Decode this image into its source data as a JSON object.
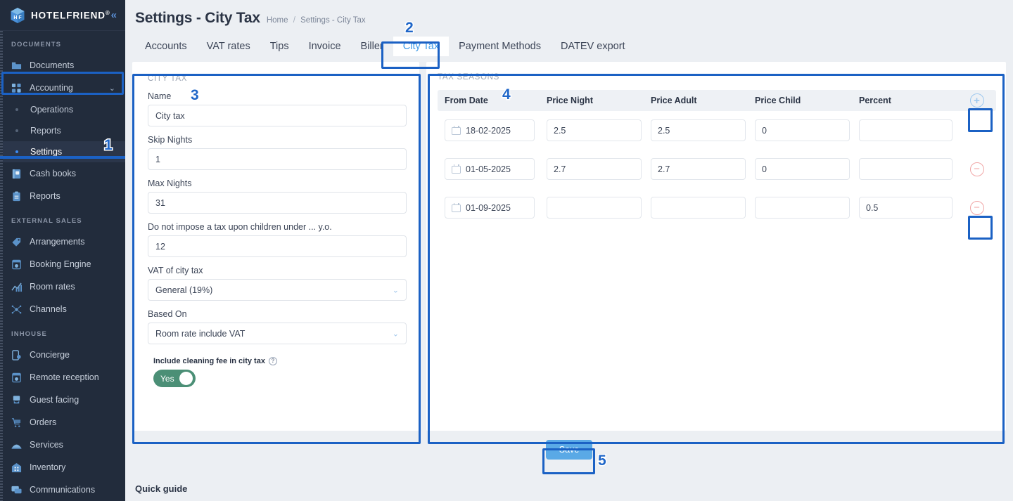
{
  "brand": {
    "name": "HOTELFRIEND",
    "registered": "®",
    "collapse_icon": "chevron-double-left"
  },
  "sidebar": {
    "groups": [
      {
        "title": "DOCUMENTS",
        "items": [
          {
            "label": "Documents",
            "icon": "folder-icon",
            "type": "item"
          },
          {
            "label": "Accounting",
            "icon": "grid-squares-icon",
            "type": "item",
            "expandable": true,
            "chevron": "⌄"
          },
          {
            "label": "Operations",
            "icon": "bullet-dot-icon",
            "type": "sub"
          },
          {
            "label": "Reports",
            "icon": "bullet-dot-icon",
            "type": "sub"
          },
          {
            "label": "Settings",
            "icon": "bullet-dot-icon",
            "type": "sub",
            "active": true
          },
          {
            "label": "Cash books",
            "icon": "cash-book-icon",
            "type": "item"
          },
          {
            "label": "Reports",
            "icon": "clipboard-icon",
            "type": "item"
          }
        ]
      },
      {
        "title": "EXTERNAL SALES",
        "items": [
          {
            "label": "Arrangements",
            "icon": "tag-icon",
            "type": "item"
          },
          {
            "label": "Booking Engine",
            "icon": "browser-gear-icon",
            "type": "item"
          },
          {
            "label": "Room rates",
            "icon": "chart-up-icon",
            "type": "item"
          },
          {
            "label": "Channels",
            "icon": "nodes-network-icon",
            "type": "item"
          }
        ]
      },
      {
        "title": "INHOUSE",
        "items": [
          {
            "label": "Concierge",
            "icon": "phone-gear-icon",
            "type": "item"
          },
          {
            "label": "Remote reception",
            "icon": "browser-gear-icon",
            "type": "item"
          },
          {
            "label": "Guest facing",
            "icon": "hand-device-icon",
            "type": "item"
          },
          {
            "label": "Orders",
            "icon": "cart-icon",
            "type": "item"
          },
          {
            "label": "Services",
            "icon": "bell-icon",
            "type": "item"
          },
          {
            "label": "Inventory",
            "icon": "building-icon",
            "type": "item"
          },
          {
            "label": "Communications",
            "icon": "chat-icon",
            "type": "item"
          }
        ]
      }
    ]
  },
  "header": {
    "title": "Settings - City Tax",
    "breadcrumb": {
      "home": "Home",
      "separator": "/",
      "current": "Settings - City Tax"
    }
  },
  "tabs": [
    {
      "label": "Accounts",
      "active": false
    },
    {
      "label": "VAT rates",
      "active": false
    },
    {
      "label": "Tips",
      "active": false
    },
    {
      "label": "Invoice",
      "active": false
    },
    {
      "label": "Biller",
      "active": false
    },
    {
      "label": "City Tax",
      "active": true
    },
    {
      "label": "Payment Methods",
      "active": false
    },
    {
      "label": "DATEV export",
      "active": false
    }
  ],
  "city_tax_panel": {
    "caption": "CITY TAX",
    "fields": [
      {
        "label": "Name",
        "value": "City tax",
        "type": "text",
        "name": "name-field"
      },
      {
        "label": "Skip Nights",
        "value": "1",
        "type": "text",
        "name": "skip-nights-field"
      },
      {
        "label": "Max Nights",
        "value": "31",
        "type": "text",
        "name": "max-nights-field"
      },
      {
        "label": "Do not impose a tax upon children under ... y.o.",
        "value": "12",
        "type": "text",
        "name": "children-age-field"
      },
      {
        "label": "VAT of city tax",
        "value": "General (19%)",
        "type": "select",
        "name": "vat-of-city-tax-select"
      },
      {
        "label": "Based On",
        "value": "Room rate include VAT",
        "type": "select",
        "name": "based-on-select"
      }
    ],
    "toggle": {
      "label": "Include cleaning fee in city tax",
      "help_icon": "?",
      "state_label": "Yes",
      "on": true,
      "on_color": "#4b8f76"
    }
  },
  "tax_seasons_panel": {
    "caption": "TAX SEASONS",
    "columns": [
      "From Date",
      "Price Night",
      "Price Adult",
      "Price Child",
      "Percent"
    ],
    "add_icon": "plus-circle-icon",
    "remove_icon": "minus-circle-icon",
    "rows": [
      {
        "from_date": "18-02-2025",
        "price_night": "2.5",
        "price_adult": "2.5",
        "price_child": "0",
        "percent": "",
        "action": "add"
      },
      {
        "from_date": "01-05-2025",
        "price_night": "2.7",
        "price_adult": "2.7",
        "price_child": "0",
        "percent": "",
        "action": "remove"
      },
      {
        "from_date": "01-09-2025",
        "price_night": "",
        "price_adult": "",
        "price_child": "",
        "percent": "0.5",
        "action": "remove"
      }
    ]
  },
  "footer": {
    "save_label": "Save",
    "quick_guide": "Quick guide"
  },
  "annotations": {
    "accent": "#1b61c4",
    "markers": [
      {
        "number": "1",
        "target": "sidebar-settings"
      },
      {
        "number": "2",
        "target": "tab-city-tax"
      },
      {
        "number": "3",
        "target": "city-tax-panel"
      },
      {
        "number": "4",
        "target": "tax-seasons-panel"
      },
      {
        "number": "5",
        "target": "save-button"
      }
    ]
  }
}
